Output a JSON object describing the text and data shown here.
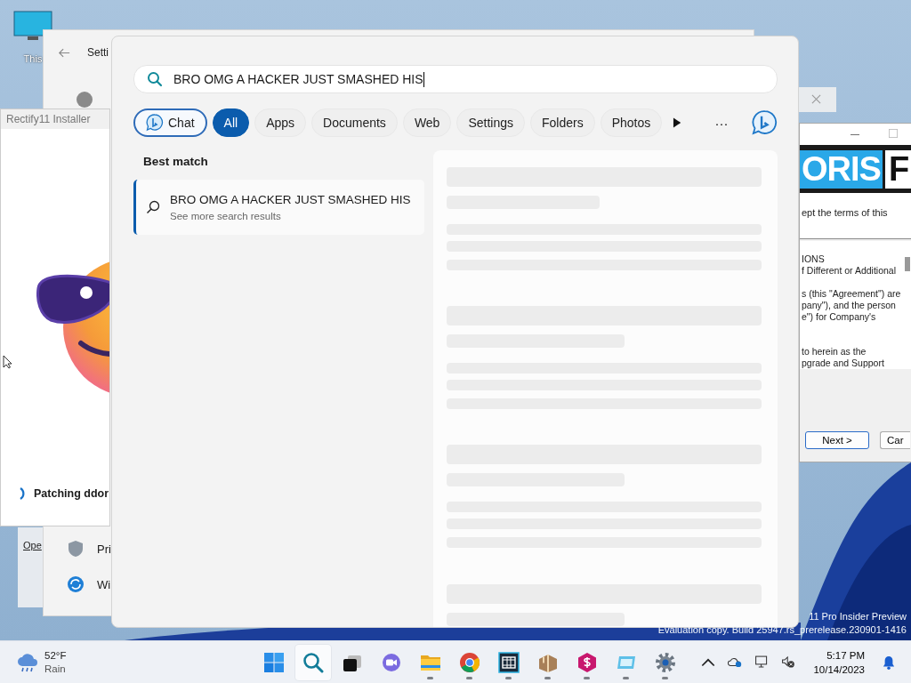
{
  "desktop_icons": [
    {
      "label": "This"
    }
  ],
  "back_window": {
    "link": "Ope"
  },
  "settings_window": {
    "title": "Setti",
    "items": [
      {
        "label": "Pri",
        "kind": "shield"
      },
      {
        "label": "Wi",
        "kind": "update"
      }
    ]
  },
  "installer_window": {
    "title": "Rectify11 Installer",
    "status": "Patching ddor"
  },
  "setup_window": {
    "banner_left": "ORIS",
    "banner_right": "F",
    "prompt": "ept the terms of this",
    "license_paragraphs": [
      [
        "IONS",
        "f Different or Additional"
      ],
      [
        "s (this \"Agreement\") are",
        "pany\"), and the person",
        "e\") for Company's"
      ],
      [
        "to herein as the",
        "pgrade and Support"
      ]
    ],
    "buttons": [
      "Next >",
      "Car"
    ]
  },
  "search": {
    "query": "BRO OMG A HACKER JUST SMASHED HIS",
    "filters": [
      {
        "label": "Chat",
        "kind": "chat",
        "selected": false
      },
      {
        "label": "All",
        "kind": "filter",
        "selected": true
      },
      {
        "label": "Apps",
        "kind": "filter",
        "selected": false
      },
      {
        "label": "Documents",
        "kind": "filter",
        "selected": false
      },
      {
        "label": "Web",
        "kind": "filter",
        "selected": false
      },
      {
        "label": "Settings",
        "kind": "filter",
        "selected": false
      },
      {
        "label": "Folders",
        "kind": "filter",
        "selected": false
      },
      {
        "label": "Photos",
        "kind": "filter",
        "selected": false
      }
    ],
    "more": "···",
    "best_match_heading": "Best match",
    "best_match": {
      "title": "BRO OMG A HACKER JUST SMASHED HIS",
      "subtitle": "See more search results",
      "selected": true
    }
  },
  "watermark_lines": [
    "11 Pro Insider Preview",
    "Evaluation copy. Build 25947.rs_prerelease.230901-1416"
  ],
  "taskbar": {
    "weather": {
      "temperature": "52°F",
      "condition": "Rain"
    },
    "apps": [
      {
        "kind": "start",
        "selected": false,
        "running": false
      },
      {
        "kind": "search",
        "selected": true,
        "running": false
      },
      {
        "kind": "taskview",
        "selected": false,
        "running": false
      },
      {
        "kind": "videochat",
        "selected": false,
        "running": false
      },
      {
        "kind": "folder",
        "selected": false,
        "running": true
      },
      {
        "kind": "browser",
        "selected": false,
        "running": true
      },
      {
        "kind": "film",
        "selected": false,
        "running": true
      },
      {
        "kind": "package",
        "selected": false,
        "running": true
      },
      {
        "kind": "hexagon",
        "selected": false,
        "running": true
      },
      {
        "kind": "card",
        "selected": false,
        "running": true
      },
      {
        "kind": "gear",
        "selected": false,
        "running": true
      }
    ],
    "clock": {
      "time": "5:17 PM",
      "date": "10/14/2023"
    }
  }
}
